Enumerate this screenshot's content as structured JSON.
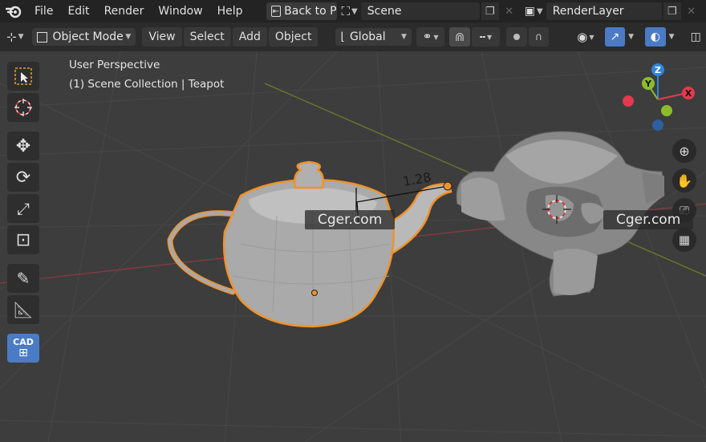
{
  "menu": {
    "items": [
      "File",
      "Edit",
      "Render",
      "Window",
      "Help"
    ],
    "back_button": "Back to P",
    "scene_label": "Scene",
    "render_layer_label": "RenderLayer"
  },
  "header": {
    "mode": "Object Mode",
    "menus": [
      "View",
      "Select",
      "Add",
      "Object"
    ],
    "transform_orientation": "Global"
  },
  "viewport": {
    "perspective_label": "User Perspective",
    "collection_label": "(1) Scene Collection | Teapot",
    "measure_label": "1.28",
    "gizmo_axes": {
      "z": "Z",
      "y": "Y",
      "x": "X"
    }
  },
  "tools": {
    "cad_label": "CAD"
  },
  "watermarks": [
    "Cger.com",
    "Cger.com"
  ],
  "colors": {
    "x_axis": "#e5394f",
    "y_axis": "#8bbd2a",
    "z_axis": "#2e86de",
    "selection": "#f0922a",
    "active_tool": "#4a7bc4"
  }
}
